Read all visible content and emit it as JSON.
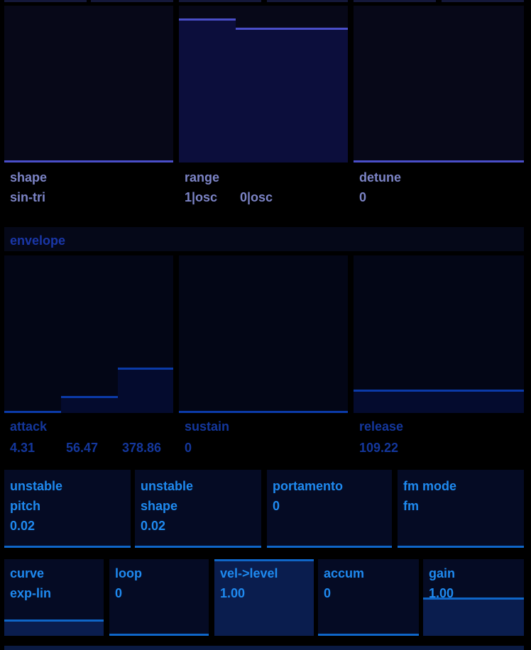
{
  "oscillator": {
    "params": [
      {
        "label": "shape",
        "values": [
          "sin-tri"
        ],
        "levels": [
          0.0
        ]
      },
      {
        "label": "range",
        "values": [
          "1|osc",
          "0|osc"
        ],
        "levels": [
          0.92,
          0.86
        ]
      },
      {
        "label": "detune",
        "values": [
          "0"
        ],
        "levels": [
          0.0
        ]
      }
    ]
  },
  "envelope": {
    "title": "envelope",
    "params": [
      {
        "label": "attack",
        "values": [
          "4.31",
          "56.47",
          "378.86"
        ],
        "levels": [
          0.01,
          0.11,
          0.29
        ]
      },
      {
        "label": "sustain",
        "values": [
          "0"
        ],
        "levels": [
          0.0
        ]
      },
      {
        "label": "release",
        "values": [
          "109.22"
        ],
        "levels": [
          0.15
        ]
      }
    ]
  },
  "controls_row1": [
    {
      "lines": [
        "unstable",
        "pitch",
        "0.02"
      ],
      "level": 0.0
    },
    {
      "lines": [
        "unstable",
        "shape",
        "0.02"
      ],
      "level": 0.0
    },
    {
      "lines": [
        "portamento",
        "0"
      ],
      "level": 0.0
    },
    {
      "lines": [
        "fm mode",
        "fm"
      ],
      "level": 0.0
    }
  ],
  "controls_row2": [
    {
      "lines": [
        "curve",
        "exp-lin"
      ],
      "level": 0.21
    },
    {
      "lines": [
        "loop",
        "0"
      ],
      "level": 0.0
    },
    {
      "lines": [
        "vel->level",
        "1.00"
      ],
      "level": 1.0
    },
    {
      "lines": [
        "accum",
        "0"
      ],
      "level": 0.0
    },
    {
      "lines": [
        "gain",
        "1.00"
      ],
      "level": 0.5
    }
  ],
  "colors": {
    "osc_accent": "#4a4ec8",
    "env_accent": "#0b3aa8",
    "control_accent": "#0f66c8",
    "control_text": "#1f8af0"
  }
}
